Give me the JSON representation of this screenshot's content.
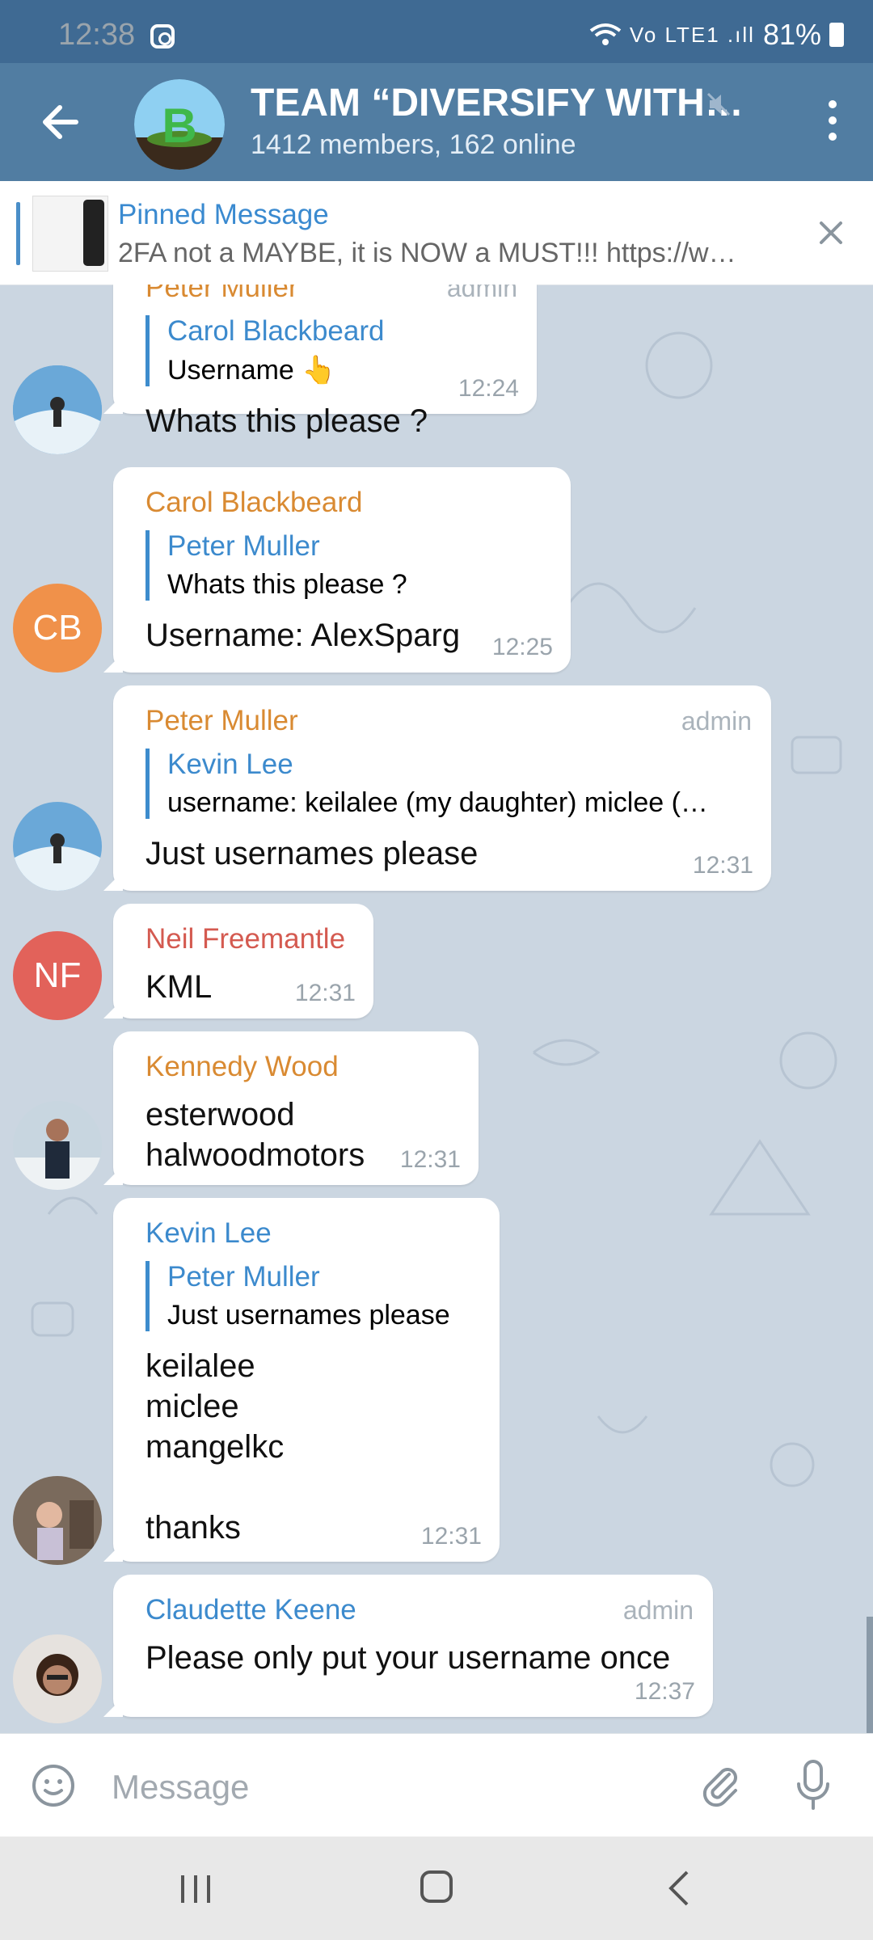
{
  "status_bar": {
    "time": "12:38",
    "signal": "Vo LTE1 .ıll",
    "battery": "81%"
  },
  "header": {
    "title": "TEAM “DIVERSIFY WITH…",
    "subtitle": "1412 members, 162 online"
  },
  "pinned": {
    "label": "Pinned Message",
    "text": "2FA not a MAYBE, it is NOW a MUST!!! https://w…"
  },
  "messages": [
    {
      "sender": "Peter Muller",
      "badge": "admin",
      "reply_name": "Carol Blackbeard",
      "reply_text": "Username 👆",
      "text": "Whats this please ?",
      "time": "12:24"
    },
    {
      "sender": "Carol Blackbeard",
      "initials": "CB",
      "reply_name": "Peter Muller",
      "reply_text": "Whats this please ?",
      "text": "Username: AlexSparg",
      "time": "12:25"
    },
    {
      "sender": "Peter Muller",
      "badge": "admin",
      "reply_name": "Kevin Lee",
      "reply_text": "username: keilalee (my daughter) miclee (…",
      "text": "Just usernames please",
      "time": "12:31"
    },
    {
      "sender": "Neil Freemantle",
      "initials": "NF",
      "text": "KML",
      "time": "12:31"
    },
    {
      "sender": "Kennedy Wood",
      "text": "esterwood\nhalwoodmotors",
      "time": "12:31"
    },
    {
      "sender": "Kevin Lee",
      "reply_name": "Peter Muller",
      "reply_text": "Just usernames please",
      "text": "keilalee\nmiclee\nmangelkc\n\nthanks",
      "time": "12:31"
    },
    {
      "sender": "Claudette Keene",
      "badge": "admin",
      "text": "Please only put your username once",
      "time": "12:37"
    }
  ],
  "input": {
    "placeholder": "Message"
  },
  "colors": {
    "header": "#517da2",
    "status": "#3f6a93",
    "chat_bg": "#cbd6e1",
    "link_blue": "#3c8acd",
    "sender_orange": "#d98a32",
    "sender_red": "#d45a50"
  }
}
